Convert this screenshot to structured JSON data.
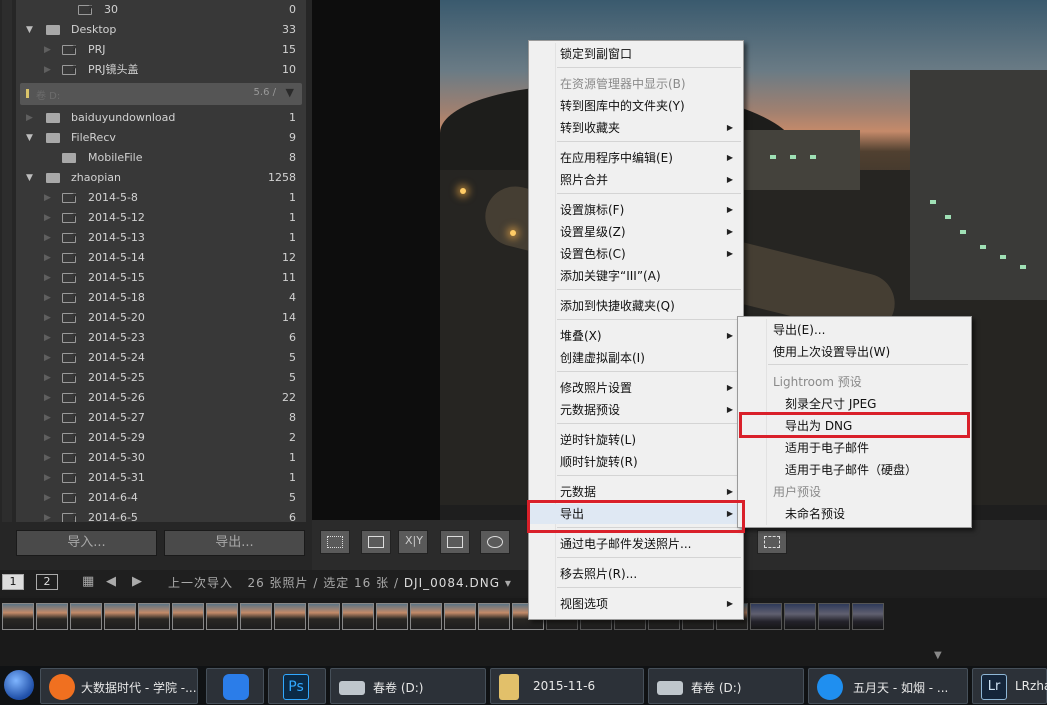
{
  "folders": {
    "rows": [
      {
        "name": "30",
        "count": "0"
      },
      {
        "name": "Desktop",
        "count": "33"
      },
      {
        "name": "PRJ",
        "count": "15"
      },
      {
        "name": "PRJ镜头盖",
        "count": "10"
      }
    ],
    "volume": {
      "name": "卷 D:",
      "size": "5.6 /"
    },
    "rows2": [
      {
        "name": "baiduyundownload",
        "count": "1"
      },
      {
        "name": "FileRecv",
        "count": "9"
      },
      {
        "name": "MobileFile",
        "count": "8"
      },
      {
        "name": "zhaopian",
        "count": "1258"
      },
      {
        "name": "2014-5-8",
        "count": "1"
      },
      {
        "name": "2014-5-12",
        "count": "1"
      },
      {
        "name": "2014-5-13",
        "count": "1"
      },
      {
        "name": "2014-5-14",
        "count": "12"
      },
      {
        "name": "2014-5-15",
        "count": "11"
      },
      {
        "name": "2014-5-18",
        "count": "4"
      },
      {
        "name": "2014-5-20",
        "count": "14"
      },
      {
        "name": "2014-5-23",
        "count": "6"
      },
      {
        "name": "2014-5-24",
        "count": "5"
      },
      {
        "name": "2014-5-25",
        "count": "5"
      },
      {
        "name": "2014-5-26",
        "count": "22"
      },
      {
        "name": "2014-5-27",
        "count": "8"
      },
      {
        "name": "2014-5-29",
        "count": "2"
      },
      {
        "name": "2014-5-30",
        "count": "1"
      },
      {
        "name": "2014-5-31",
        "count": "1"
      },
      {
        "name": "2014-6-4",
        "count": "5"
      },
      {
        "name": "2014-6-5",
        "count": "6"
      }
    ],
    "import_label": "导入...",
    "export_label": "导出..."
  },
  "filmbar": {
    "page1": "1",
    "page2": "2",
    "source": "上一次导入",
    "summary": "26 张照片 / 选定 16 张 /",
    "filename": "DJI_0084.DNG"
  },
  "toolbar": {
    "xy_label": "X|Y"
  },
  "context_menu": {
    "items": [
      {
        "label": "锁定到副窗口"
      },
      {
        "label": "在资源管理器中显示(B)"
      },
      {
        "label": "转到图库中的文件夹(Y)"
      },
      {
        "label": "转到收藏夹"
      },
      {
        "label": "在应用程序中编辑(E)"
      },
      {
        "label": "照片合并"
      },
      {
        "label": "设置旗标(F)"
      },
      {
        "label": "设置星级(Z)"
      },
      {
        "label": "设置色标(C)"
      },
      {
        "label": "添加关键字“III”(A)"
      },
      {
        "label": "添加到快捷收藏夹(Q)"
      },
      {
        "label": "堆叠(X)"
      },
      {
        "label": "创建虚拟副本(I)"
      },
      {
        "label": "修改照片设置"
      },
      {
        "label": "元数据预设"
      },
      {
        "label": "逆时针旋转(L)"
      },
      {
        "label": "顺时针旋转(R)"
      },
      {
        "label": "元数据"
      },
      {
        "label": "导出"
      },
      {
        "label": "通过电子邮件发送照片..."
      },
      {
        "label": "移去照片(R)..."
      },
      {
        "label": "视图选项"
      }
    ]
  },
  "export_submenu": {
    "items": [
      {
        "label": "导出(E)..."
      },
      {
        "label": "使用上次设置导出(W)"
      },
      {
        "label": "Lightroom 预设"
      },
      {
        "label": "刻录全尺寸 JPEG"
      },
      {
        "label": "导出为 DNG"
      },
      {
        "label": "适用于电子邮件"
      },
      {
        "label": "适用于电子邮件（硬盘）"
      },
      {
        "label": "用户预设"
      },
      {
        "label": "未命名预设"
      }
    ]
  },
  "taskbar": {
    "items": [
      {
        "label": "大数据时代 - 学院 -..."
      },
      {
        "label": "Ps"
      },
      {
        "label": "春卷 (D:)"
      },
      {
        "label": "2015-11-6"
      },
      {
        "label": "春卷 (D:)"
      },
      {
        "label": "五月天 - 如烟 - ..."
      },
      {
        "label": "Lr"
      },
      {
        "label": "LRzha"
      }
    ]
  },
  "colors": {
    "highlight": "#d9202a",
    "menu_bg": "#f0f0f0",
    "panel_bg": "#383838"
  }
}
